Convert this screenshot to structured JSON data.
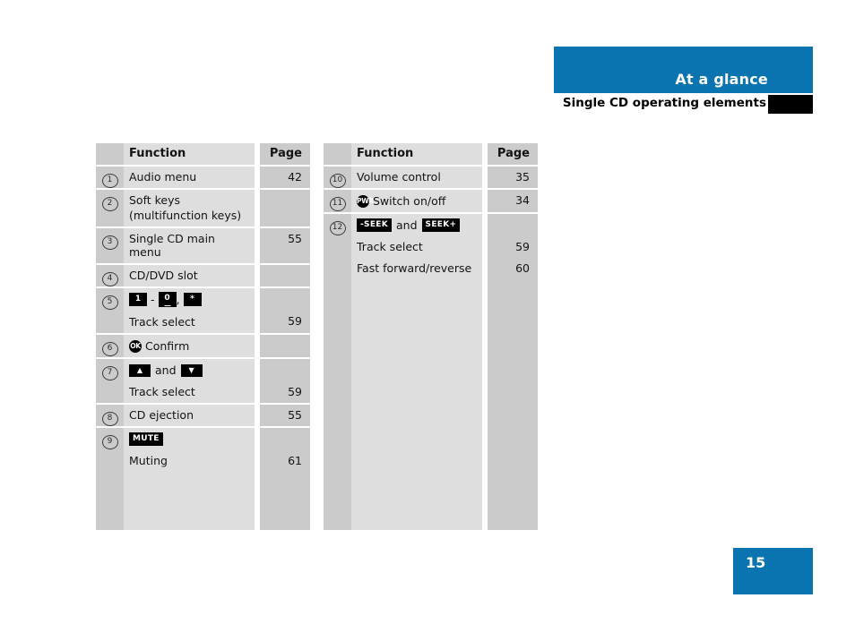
{
  "header": {
    "title": "At a glance",
    "subtitle": "Single CD operating elements",
    "bar_color": "#0a74b0"
  },
  "footer": {
    "page_number": "15",
    "badge_color": "#0a74b0"
  },
  "tables": {
    "left": {
      "columns": {
        "num": "",
        "function": "Function",
        "page": "Page"
      },
      "rows": [
        {
          "num": "1",
          "function": "Audio menu",
          "page": "42"
        },
        {
          "num": "2",
          "function": "Soft keys",
          "function_line2": "(multifunction keys)",
          "page": ""
        },
        {
          "num": "3",
          "function": "Single CD main menu",
          "page": "55"
        },
        {
          "num": "4",
          "function": "CD/DVD slot",
          "page": ""
        },
        {
          "num": "5",
          "keys": [
            "1",
            "0",
            "*"
          ],
          "dash": "-",
          "comma": ",",
          "sub_label": "Track select",
          "sub_page": "59"
        },
        {
          "num": "6",
          "icon": "OK",
          "function": "Confirm",
          "page": ""
        },
        {
          "num": "7",
          "arrow_up": "▲",
          "and": "and",
          "arrow_down": "▼",
          "sub_label": "Track select",
          "sub_page": "59"
        },
        {
          "num": "8",
          "function": "CD ejection",
          "page": "55"
        },
        {
          "num": "9",
          "badge": "MUTE",
          "sub_label": "Muting",
          "sub_page": "61"
        }
      ]
    },
    "right": {
      "columns": {
        "num": "",
        "function": "Function",
        "page": "Page"
      },
      "rows": [
        {
          "num": "10",
          "function": "Volume control",
          "page": "35"
        },
        {
          "num": "11",
          "icon": "PWR",
          "function": "Switch on/off",
          "page": "34"
        },
        {
          "num": "12",
          "key_left": "-SEEK",
          "and": "and",
          "key_right": "SEEK+",
          "sub_label": "Track select",
          "sub_page": "59",
          "sub_label2": "Fast forward/reverse",
          "sub_page2": "60"
        }
      ]
    }
  },
  "colors": {
    "col_num_bg": "#cbcbcb",
    "col_func_bg": "#dedede",
    "col_page_bg": "#cbcbcb",
    "row_divider": "#ffffff"
  }
}
